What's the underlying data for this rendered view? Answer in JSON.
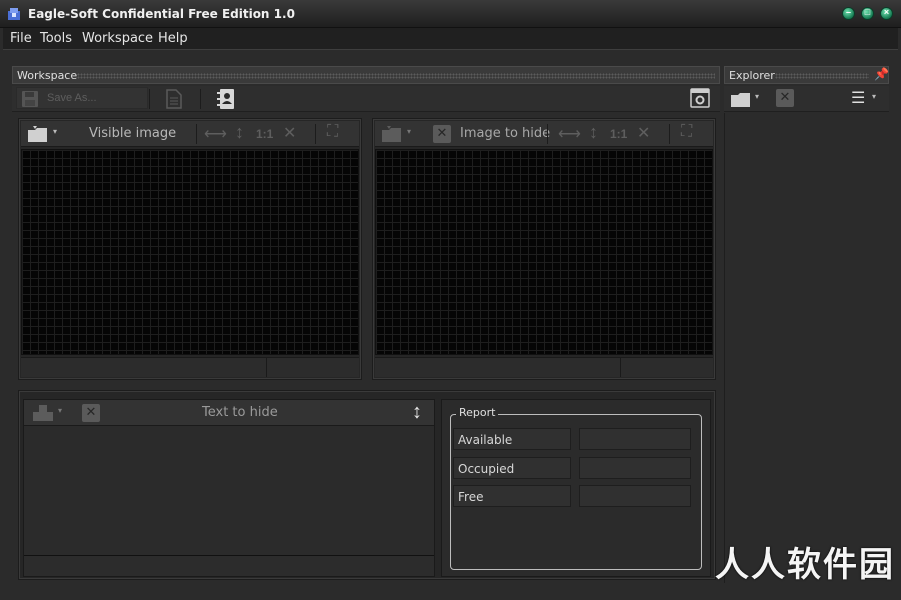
{
  "window": {
    "title": "Eagle-Soft Confidential Free Edition 1.0",
    "controls": [
      "minimize",
      "maximize",
      "close"
    ]
  },
  "menu": {
    "items": [
      "File",
      "Tools",
      "Workspace",
      "Help"
    ]
  },
  "workspace": {
    "header": "Workspace",
    "toolbar": {
      "save_as_label": "Save As...",
      "save_as_enabled": false
    },
    "visible_image_panel": {
      "title": "Visible image",
      "tools": [
        "open-folder-icon",
        "fit-width-icon",
        "fit-height-icon",
        "actual-size-icon",
        "fit-all-icon",
        "fullscreen-icon"
      ],
      "actual_size_label": "1:1"
    },
    "hide_image_panel": {
      "title": "Image to hide",
      "actual_size_label": "1:1"
    },
    "text_panel": {
      "title": "Text to hide"
    },
    "report": {
      "title": "Report",
      "rows": [
        {
          "label": "Available",
          "value": ""
        },
        {
          "label": "Occupied",
          "value": ""
        },
        {
          "label": "Free",
          "value": ""
        }
      ]
    }
  },
  "explorer": {
    "header": "Explorer"
  },
  "watermark": "人人软件园",
  "colors": {
    "background": "#2b2b2b",
    "title_button": "#2fb67d",
    "canvas": "#050505"
  }
}
